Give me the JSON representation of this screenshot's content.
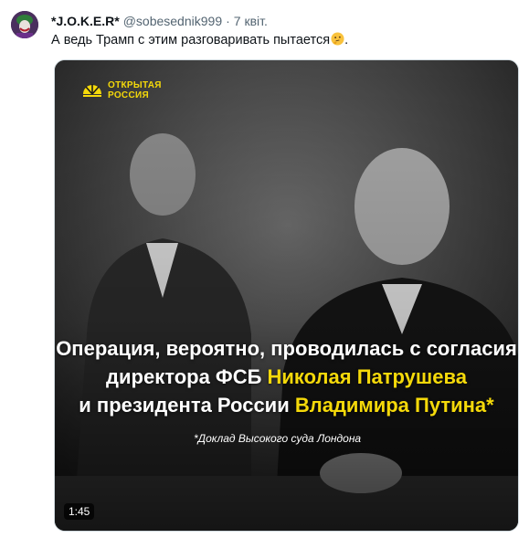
{
  "author": {
    "display_name": "*J.O.K.E.R*",
    "handle": "@sobesednik999",
    "separator": "·",
    "time": "7 квіт."
  },
  "tweet": {
    "text": "А ведь Трамп с этим разговаривать пытается",
    "emoji": "thinking-face",
    "trailing": "."
  },
  "media": {
    "logo": {
      "line1": "ОТКРЫТАЯ",
      "line2": "РОССИЯ"
    },
    "caption": {
      "line1": "Операция, вероятно, проводилась с согласия",
      "line2_prefix": "директора ФСБ ",
      "line2_highlight": "Николая Патрушева",
      "line3_prefix": "и президента России ",
      "line3_highlight": "Владимира Путина*"
    },
    "footnote": "*Доклад Высокого суда Лондона",
    "duration": "1:45",
    "accent_color": "#f5d90a"
  }
}
